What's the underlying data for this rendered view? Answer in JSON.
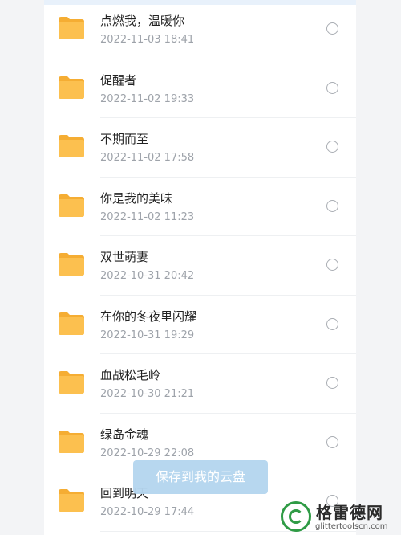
{
  "files": [
    {
      "name": "点燃我，温暖你",
      "date": "2022-11-03 18:41",
      "icon": "folder-icon"
    },
    {
      "name": "促醒者",
      "date": "2022-11-02 19:33",
      "icon": "folder-icon"
    },
    {
      "name": "不期而至",
      "date": "2022-11-02 17:58",
      "icon": "folder-icon"
    },
    {
      "name": "你是我的美味",
      "date": "2022-11-02 11:23",
      "icon": "folder-icon"
    },
    {
      "name": "双世萌妻",
      "date": "2022-10-31 20:42",
      "icon": "folder-icon"
    },
    {
      "name": "在你的冬夜里闪耀",
      "date": "2022-10-31 19:29",
      "icon": "folder-icon"
    },
    {
      "name": "血战松毛岭",
      "date": "2022-10-30 21:21",
      "icon": "folder-icon"
    },
    {
      "name": "绿岛金魂",
      "date": "2022-10-29 22:08",
      "icon": "folder-icon"
    },
    {
      "name": "回到明天",
      "date": "2022-10-29 17:44",
      "icon": "folder-icon"
    }
  ],
  "save_button": {
    "label": "保存到我的云盘"
  },
  "watermark": {
    "title": "格雷德网",
    "url": "glittertoolscn.com"
  },
  "colors": {
    "folder": "#fcc04f",
    "folder_dark": "#f5ad33",
    "button": "#b5d6ef",
    "watermark_green": "#2f9b45"
  }
}
